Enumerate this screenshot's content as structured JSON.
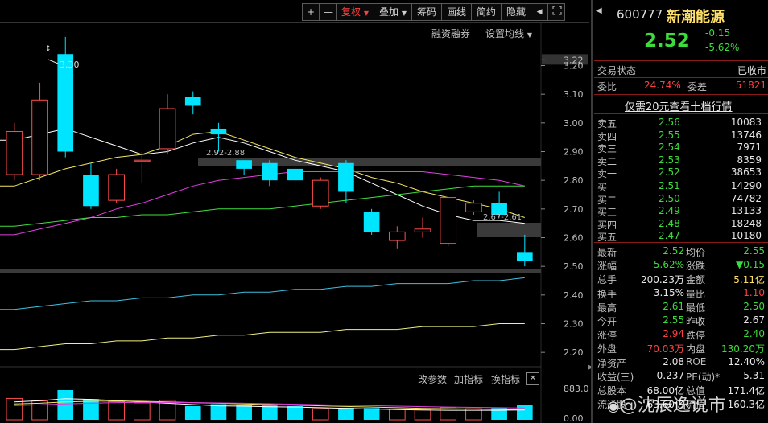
{
  "toolbar": {
    "plus": "+",
    "minus": "—",
    "fuquan": "复权",
    "diejia": "叠加",
    "chouma": "筹码",
    "huaxian": "画线",
    "jianyue": "简约",
    "yincang": "隐藏",
    "arrow_left": "◀",
    "arrow_right": "▶"
  },
  "main_menu": {
    "margin": "融资融券",
    "ma_setting": "设置均线"
  },
  "annotations": {
    "high": "3.30",
    "range1": "2.92-2.88",
    "range2": "2.67-2.61"
  },
  "price_axis": [
    "3.22",
    "3.20",
    "3.10",
    "3.00",
    "2.90",
    "2.80",
    "2.70",
    "2.60",
    "2.50",
    "2.40",
    "2.30",
    "2.20"
  ],
  "sub_menu": {
    "change_param": "改参数",
    "add_indicator": "加指标",
    "switch_indicator": "换指标"
  },
  "volume_axis": [
    "883.00",
    "0.00"
  ],
  "stock": {
    "code": "600777",
    "name": "新潮能源",
    "price": "2.52",
    "change": "-0.15",
    "change_pct": "-5.62%"
  },
  "trade_status": {
    "label": "交易状态",
    "value": "已收市"
  },
  "weibi": {
    "label": "委比",
    "value": "24.74%",
    "label2": "委差",
    "value2": "51821"
  },
  "promo": "仅需20元查看十档行情",
  "asks": [
    {
      "label": "卖五",
      "price": "2.56",
      "vol": "10083"
    },
    {
      "label": "卖四",
      "price": "2.55",
      "vol": "13746"
    },
    {
      "label": "卖三",
      "price": "2.54",
      "vol": "7971"
    },
    {
      "label": "卖二",
      "price": "2.53",
      "vol": "8359"
    },
    {
      "label": "卖一",
      "price": "2.52",
      "vol": "38653"
    }
  ],
  "bids": [
    {
      "label": "买一",
      "price": "2.51",
      "vol": "14290"
    },
    {
      "label": "买二",
      "price": "2.50",
      "vol": "74782"
    },
    {
      "label": "买三",
      "price": "2.49",
      "vol": "13133"
    },
    {
      "label": "买四",
      "price": "2.48",
      "vol": "18248"
    },
    {
      "label": "买五",
      "price": "2.47",
      "vol": "10180"
    }
  ],
  "stats": [
    {
      "l1": "最新",
      "v1": "2.52",
      "c1": "green",
      "l2": "均价",
      "v2": "2.55",
      "c2": "green"
    },
    {
      "l1": "涨幅",
      "v1": "-5.62%",
      "c1": "green",
      "l2": "涨跌",
      "v2": "▼0.15",
      "c2": "green"
    },
    {
      "l1": "总手",
      "v1": "200.23万",
      "c1": "white",
      "l2": "金额",
      "v2": "5.11亿",
      "c2": "yellow"
    },
    {
      "l1": "换手",
      "v1": "3.15%",
      "c1": "white",
      "l2": "量比",
      "v2": "1.10",
      "c2": "red"
    },
    {
      "l1": "最高",
      "v1": "2.61",
      "c1": "green",
      "l2": "最低",
      "v2": "2.50",
      "c2": "green"
    },
    {
      "l1": "今开",
      "v1": "2.55",
      "c1": "green",
      "l2": "昨收",
      "v2": "2.67",
      "c2": "white"
    },
    {
      "l1": "涨停",
      "v1": "2.94",
      "c1": "red",
      "l2": "跌停",
      "v2": "2.40",
      "c2": "green"
    },
    {
      "l1": "外盘",
      "v1": "70.03万",
      "c1": "red",
      "l2": "内盘",
      "v2": "130.20万",
      "c2": "green"
    },
    {
      "l1": "净资产",
      "v1": "2.08",
      "c1": "white",
      "l2": "ROE",
      "v2": "12.40%",
      "c2": "white"
    },
    {
      "l1": "收益(三)",
      "v1": "0.237",
      "c1": "white",
      "l2": "PE(动)*",
      "v2": "5.31",
      "c2": "white"
    },
    {
      "l1": "总股本",
      "v1": "68.00亿",
      "c1": "white",
      "l2": "总值",
      "v2": "171.4亿",
      "c2": "white"
    },
    {
      "l1": "流通股",
      "v1": "63.60亿",
      "c1": "white",
      "l2": "流值",
      "v2": "160.3亿",
      "c2": "white"
    }
  ],
  "watermark": "@沈辰逸说市",
  "chart_data": {
    "type": "candlestick",
    "candles": [
      {
        "o": 2.82,
        "c": 2.97,
        "h": 3.0,
        "l": 2.8
      },
      {
        "o": 2.82,
        "c": 3.08,
        "h": 3.14,
        "l": 2.8
      },
      {
        "o": 3.24,
        "c": 2.9,
        "h": 3.3,
        "l": 2.88
      },
      {
        "o": 2.82,
        "c": 2.71,
        "h": 2.86,
        "l": 2.7
      },
      {
        "o": 2.73,
        "c": 2.82,
        "h": 2.84,
        "l": 2.72
      },
      {
        "o": 2.87,
        "c": 2.87,
        "h": 2.9,
        "l": 2.79
      },
      {
        "o": 2.91,
        "c": 3.05,
        "h": 3.1,
        "l": 2.89
      },
      {
        "o": 3.09,
        "c": 3.06,
        "h": 3.11,
        "l": 3.03
      },
      {
        "o": 2.98,
        "c": 2.96,
        "h": 3.0,
        "l": 2.9
      },
      {
        "o": 2.87,
        "c": 2.84,
        "h": 2.87,
        "l": 2.82
      },
      {
        "o": 2.86,
        "c": 2.8,
        "h": 2.87,
        "l": 2.78
      },
      {
        "o": 2.84,
        "c": 2.8,
        "h": 2.87,
        "l": 2.78
      },
      {
        "o": 2.71,
        "c": 2.8,
        "h": 2.81,
        "l": 2.7
      },
      {
        "o": 2.86,
        "c": 2.76,
        "h": 2.87,
        "l": 2.72
      },
      {
        "o": 2.69,
        "c": 2.62,
        "h": 2.7,
        "l": 2.61
      },
      {
        "o": 2.59,
        "c": 2.62,
        "h": 2.64,
        "l": 2.56
      },
      {
        "o": 2.62,
        "c": 2.63,
        "h": 2.67,
        "l": 2.6
      },
      {
        "o": 2.58,
        "c": 2.74,
        "h": 2.74,
        "l": 2.57
      },
      {
        "o": 2.69,
        "c": 2.72,
        "h": 2.73,
        "l": 2.68
      },
      {
        "o": 2.72,
        "c": 2.68,
        "h": 2.76,
        "l": 2.67
      },
      {
        "o": 2.55,
        "c": 2.52,
        "h": 2.61,
        "l": 2.5
      }
    ],
    "ma": [
      {
        "color": "#ffffff",
        "values": [
          2.94,
          2.96,
          2.98,
          2.95,
          2.92,
          2.89,
          2.9,
          2.93,
          2.95,
          2.93,
          2.9,
          2.87,
          2.85,
          2.83,
          2.79,
          2.75,
          2.71,
          2.68,
          2.66,
          2.66,
          2.65
        ]
      },
      {
        "color": "#f5e663",
        "values": [
          2.78,
          2.81,
          2.84,
          2.86,
          2.88,
          2.89,
          2.92,
          2.96,
          2.97,
          2.94,
          2.91,
          2.88,
          2.86,
          2.84,
          2.81,
          2.79,
          2.76,
          2.74,
          2.72,
          2.7,
          2.67
        ]
      },
      {
        "color": "#e040e0",
        "values": [
          2.61,
          2.63,
          2.65,
          2.67,
          2.7,
          2.72,
          2.75,
          2.78,
          2.8,
          2.81,
          2.82,
          2.83,
          2.83,
          2.83,
          2.83,
          2.83,
          2.83,
          2.82,
          2.81,
          2.8,
          2.78
        ]
      },
      {
        "color": "#40e040",
        "values": [
          2.64,
          2.65,
          2.66,
          2.67,
          2.67,
          2.68,
          2.68,
          2.69,
          2.7,
          2.7,
          2.7,
          2.71,
          2.72,
          2.73,
          2.74,
          2.75,
          2.76,
          2.77,
          2.78,
          2.78,
          2.78
        ]
      },
      {
        "color": "#40c0e0",
        "values": [
          2.35,
          2.36,
          2.37,
          2.38,
          2.38,
          2.39,
          2.39,
          2.4,
          2.4,
          2.41,
          2.41,
          2.42,
          2.42,
          2.43,
          2.43,
          2.44,
          2.44,
          2.44,
          2.45,
          2.45,
          2.46
        ]
      },
      {
        "color": "#f0f080",
        "values": [
          2.21,
          2.22,
          2.23,
          2.23,
          2.24,
          2.24,
          2.25,
          2.25,
          2.26,
          2.26,
          2.27,
          2.27,
          2.27,
          2.28,
          2.28,
          2.28,
          2.29,
          2.29,
          2.29,
          2.3,
          2.3
        ]
      }
    ],
    "ylim": [
      2.15,
      3.35
    ],
    "volume": [
      620,
      540,
      883,
      600,
      520,
      480,
      560,
      380,
      440,
      420,
      400,
      380,
      300,
      330,
      320,
      280,
      260,
      340,
      300,
      320,
      410
    ],
    "volume_ylim": [
      0,
      883
    ]
  }
}
